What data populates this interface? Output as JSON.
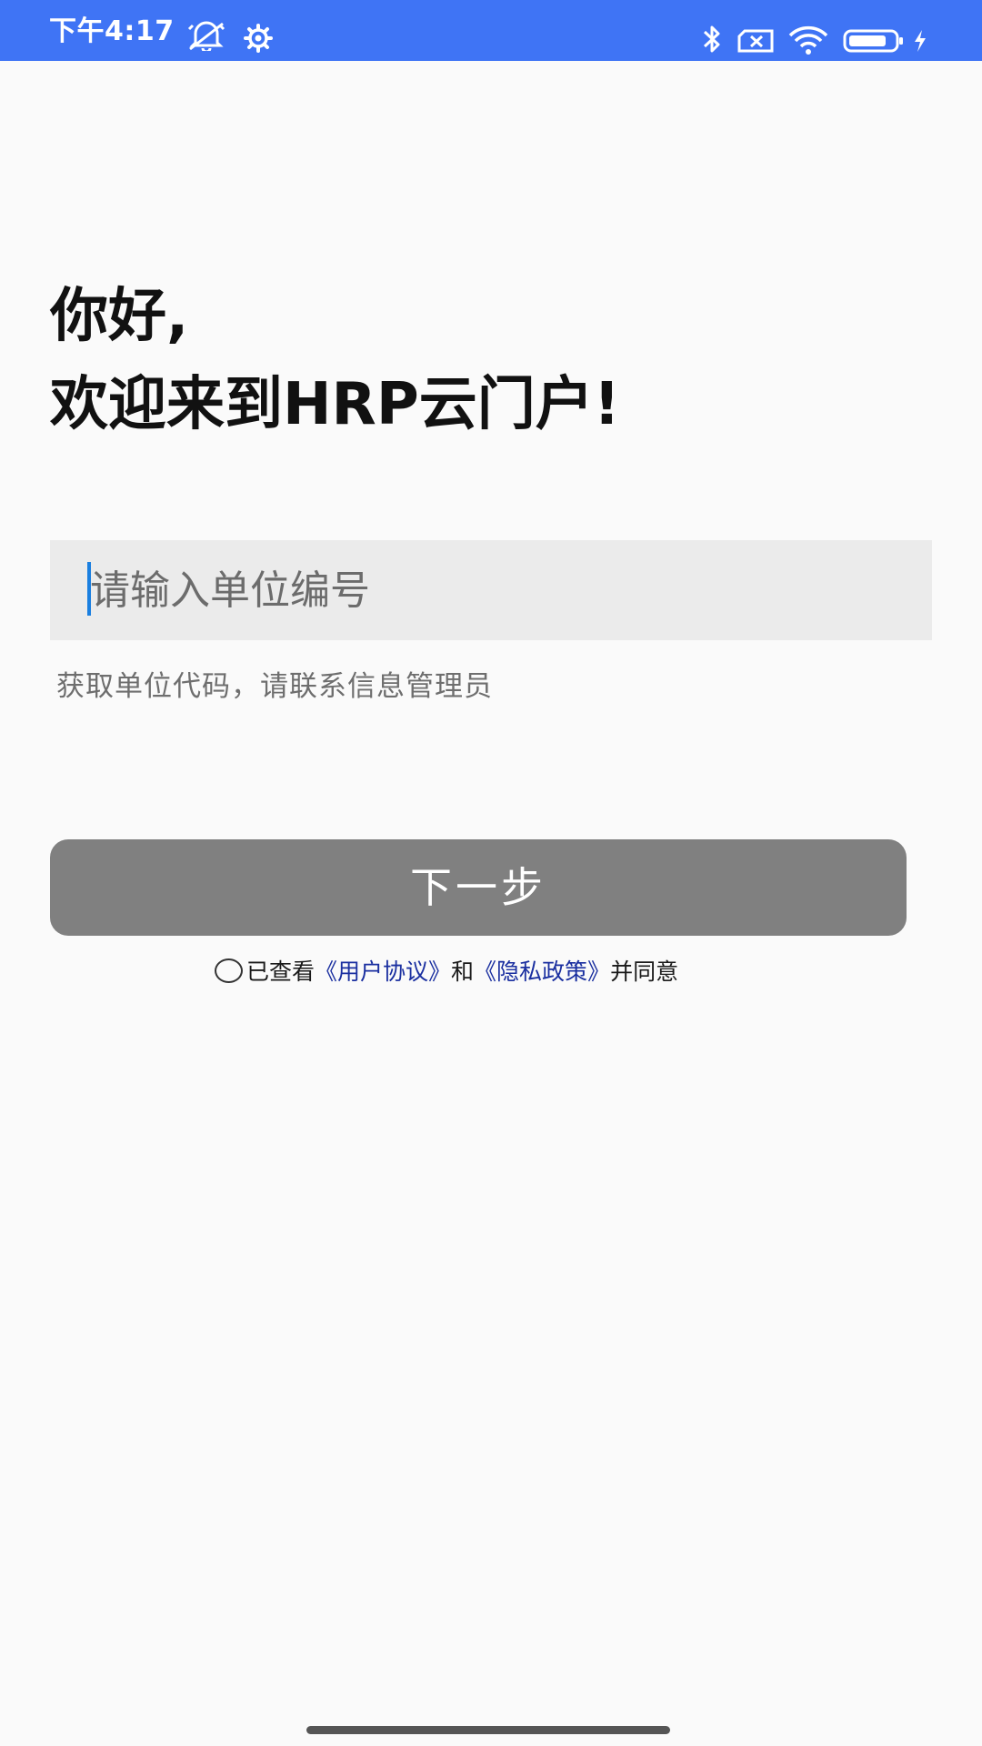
{
  "status_bar": {
    "time": "下午4:17",
    "icons": [
      "alarm-off-icon",
      "gear-icon",
      "bluetooth-icon",
      "sim-card-icon",
      "wifi-icon",
      "battery-icon",
      "charging-icon"
    ]
  },
  "greeting": {
    "line1": "你好,",
    "line2": "欢迎来到HRP云门户!"
  },
  "unit_input": {
    "placeholder": "请输入单位编号",
    "value": ""
  },
  "hint": "获取单位代码，请联系信息管理员",
  "next_button": {
    "label": "下一步"
  },
  "agreement": {
    "checked": false,
    "prefix": "已查看",
    "user_agreement": "《用户协议》",
    "and": "和",
    "privacy_policy": "《隐私政策》",
    "suffix": "并同意"
  },
  "colors": {
    "status_bar": "#3f74f5",
    "button": "#808080",
    "link": "#1a2fa0",
    "input_bg": "#ebebeb",
    "caret": "#1a7fe0"
  }
}
